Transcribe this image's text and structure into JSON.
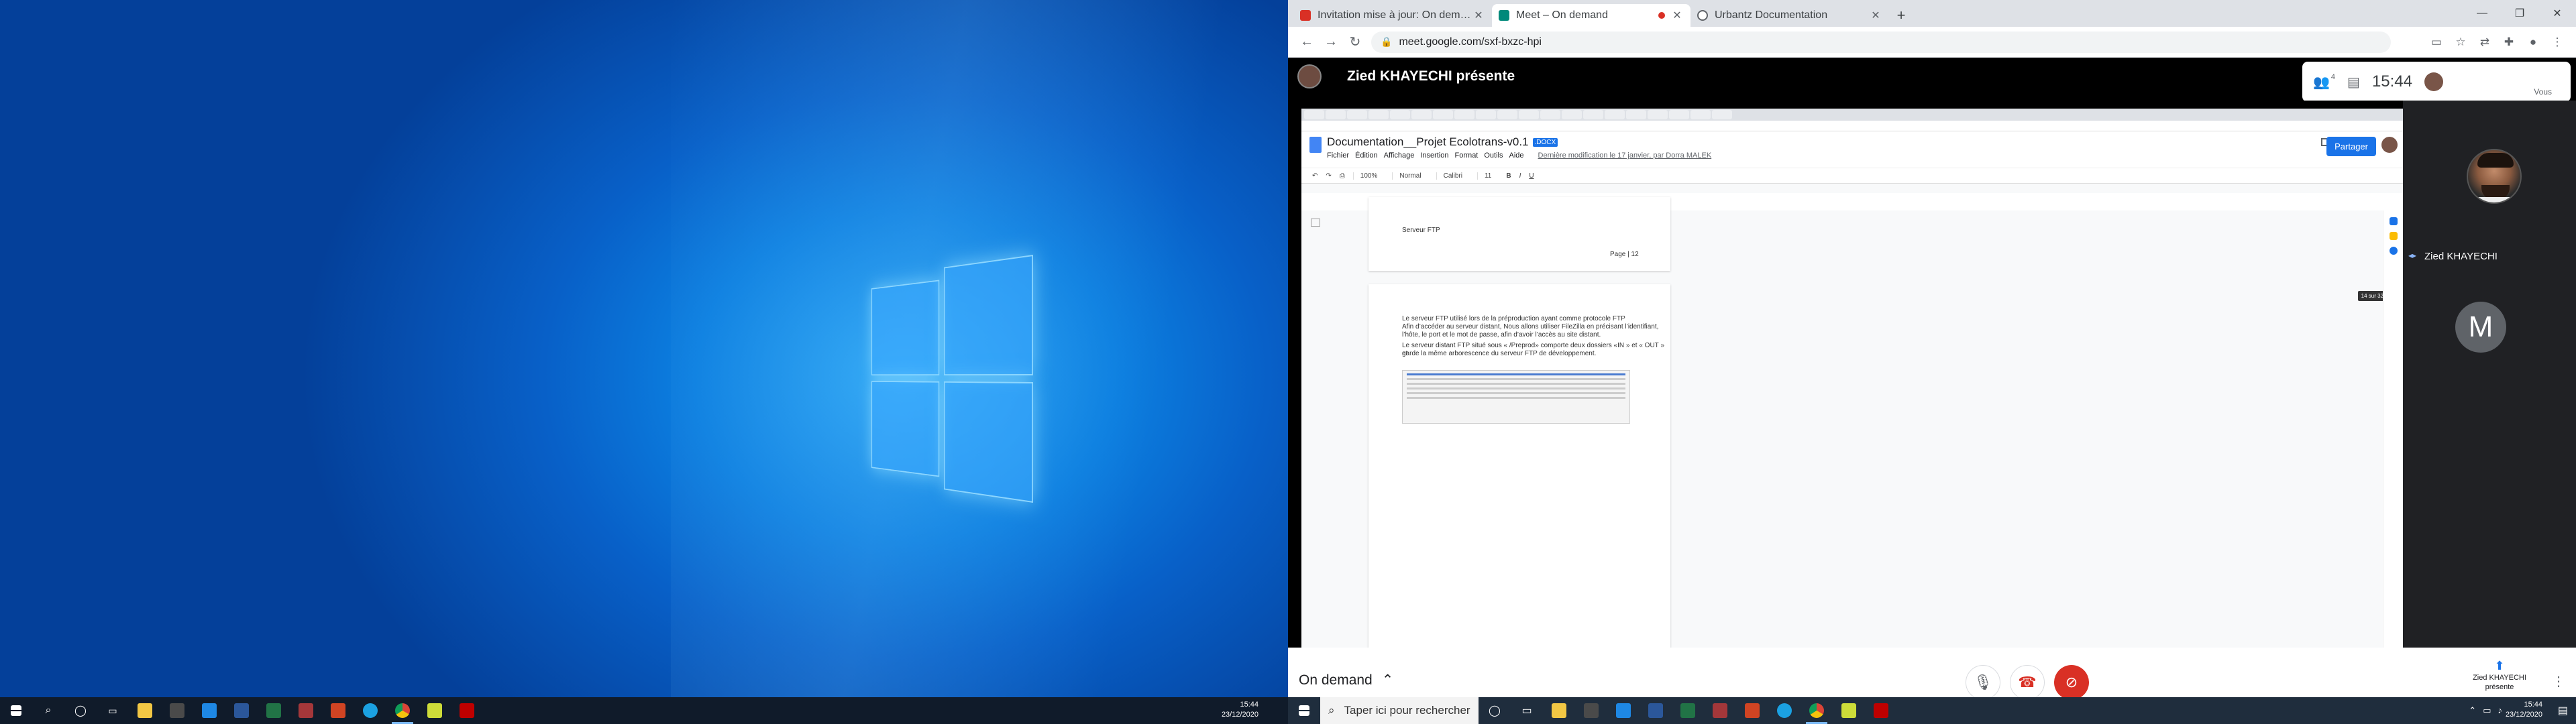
{
  "left_monitor": {
    "taskbar": {
      "time": "15:44",
      "date": "23/12/2020",
      "icons": [
        "windows-start-icon",
        "search-icon",
        "task-view-icon",
        "widgets-icon",
        "file-explorer-icon",
        "store-icon",
        "mail-icon",
        "word-icon",
        "excel-icon",
        "powerpoint-icon",
        "access-icon",
        "edge-icon",
        "chrome-icon",
        "notepad-icon",
        "filezilla-icon"
      ]
    }
  },
  "browser": {
    "tabs": [
      {
        "title": "Invitation mise à jour: On demand",
        "favicon_color": "#d93025"
      },
      {
        "title": "Meet – On demand",
        "favicon_color": "#00897b",
        "recording": true
      },
      {
        "title": "Urbantz Documentation",
        "favicon_color": "#5f6368"
      }
    ],
    "url": "meet.google.com/sxf-bxzc-hpi"
  },
  "meet": {
    "presenter_label": "Zied KHAYECHI présente",
    "clock": "15:44",
    "self_label": "Vous",
    "participant_count": "4",
    "tiles": [
      {
        "name": "Zied KHAYECHI"
      },
      {
        "initial": "M"
      }
    ],
    "meeting_name": "On demand",
    "present_label_line1": "Zied KHAYECHI",
    "present_label_line2": "présente"
  },
  "shared_doc": {
    "title": "Documentation__Projet Ecolotrans-v0.1",
    "badge": ".DOCX",
    "menu": [
      "Fichier",
      "Édition",
      "Affichage",
      "Insertion",
      "Format",
      "Outils",
      "Aide"
    ],
    "last_modified": "Dernière modification le 17 janvier, par Dorra MALEK",
    "share_button": "Partager",
    "toolbar": {
      "zoom": "100%",
      "style": "Normal",
      "font": "Calibri",
      "size": "11"
    },
    "page1_heading": "Serveur FTP",
    "page1_footer": "Page | 12",
    "page_indicator": "14 sur 32",
    "para1_l1": "Le serveur FTP utilisé lors de la préproduction ayant comme protocole FTP",
    "para1_l2": "Afin d’accéder au serveur distant, Nous allons utiliser FileZilla en précisant l’identifiant,",
    "para1_l3": "l’hôte, le port et le mot de passe, afin d’avoir l’accès au site distant.",
    "para2_l1": "Le serveur distant FTP situé sous « /Preprod» comporte deux dossiers «IN » et « OUT » et",
    "para2_l2": "garde la même arborescence du serveur FTP de développement."
  },
  "right_taskbar": {
    "search_placeholder": "Taper ici pour rechercher",
    "time": "15:44",
    "date": "23/12/2020"
  }
}
